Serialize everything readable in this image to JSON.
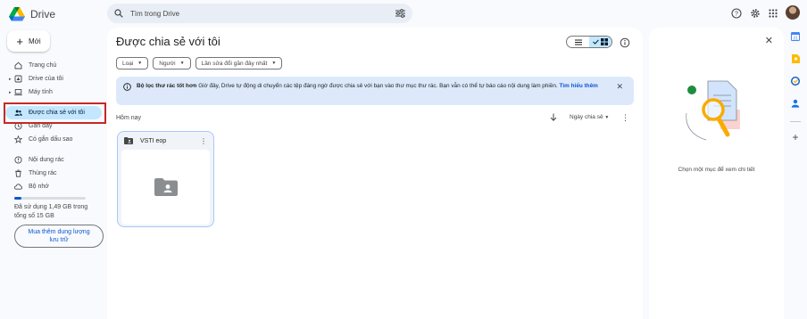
{
  "app": {
    "name": "Drive"
  },
  "search": {
    "placeholder": "Tìm trong Drive"
  },
  "sidebar": {
    "new_label": "Mới",
    "items": [
      {
        "label": "Trang chủ",
        "icon": "home-icon"
      },
      {
        "label": "Drive của tôi",
        "icon": "my-drive-icon"
      },
      {
        "label": "Máy tính",
        "icon": "computer-icon"
      },
      {
        "label": "Được chia sẻ với tôi",
        "icon": "shared-people-icon",
        "active": true
      },
      {
        "label": "Gần đây",
        "icon": "clock-icon"
      },
      {
        "label": "Có gắn dấu sao",
        "icon": "star-icon"
      },
      {
        "label": "Nội dung rác",
        "icon": "spam-icon"
      },
      {
        "label": "Thùng rác",
        "icon": "trash-icon"
      },
      {
        "label": "Bộ nhớ",
        "icon": "cloud-icon"
      }
    ],
    "storage_used_fraction": 0.1,
    "storage_text": "Đã sử dụng 1,49 GB trong tổng số 15 GB",
    "buy_storage_label": "Mua thêm dung lượng lưu trữ"
  },
  "main": {
    "title": "Được chia sẻ với tôi",
    "filters": [
      "Loại",
      "Người",
      "Lần sửa đổi gần đây nhất"
    ],
    "banner": {
      "title": "Bộ lọc thư rác tốt hơn",
      "text": "Giờ đây, Drive tự động di chuyển các tệp đáng ngờ được chia sẻ với bạn vào thư mục thư rác. Bạn vẫn có thể tự báo cáo nội dung làm phiền.",
      "link": "Tìm hiểu thêm",
      "close": "✕"
    },
    "section_label": "Hôm nay",
    "sort_label": "Ngày chia sẻ",
    "card": {
      "name": "VSTI eop"
    }
  },
  "details": {
    "placeholder": "Chọn một mục để xem chi tiết",
    "close": "✕"
  },
  "colors": {
    "accent": "#0b57d0",
    "active_bg": "#c2e7ff",
    "banner_bg": "#dde9fb",
    "highlight": "#c62828"
  }
}
